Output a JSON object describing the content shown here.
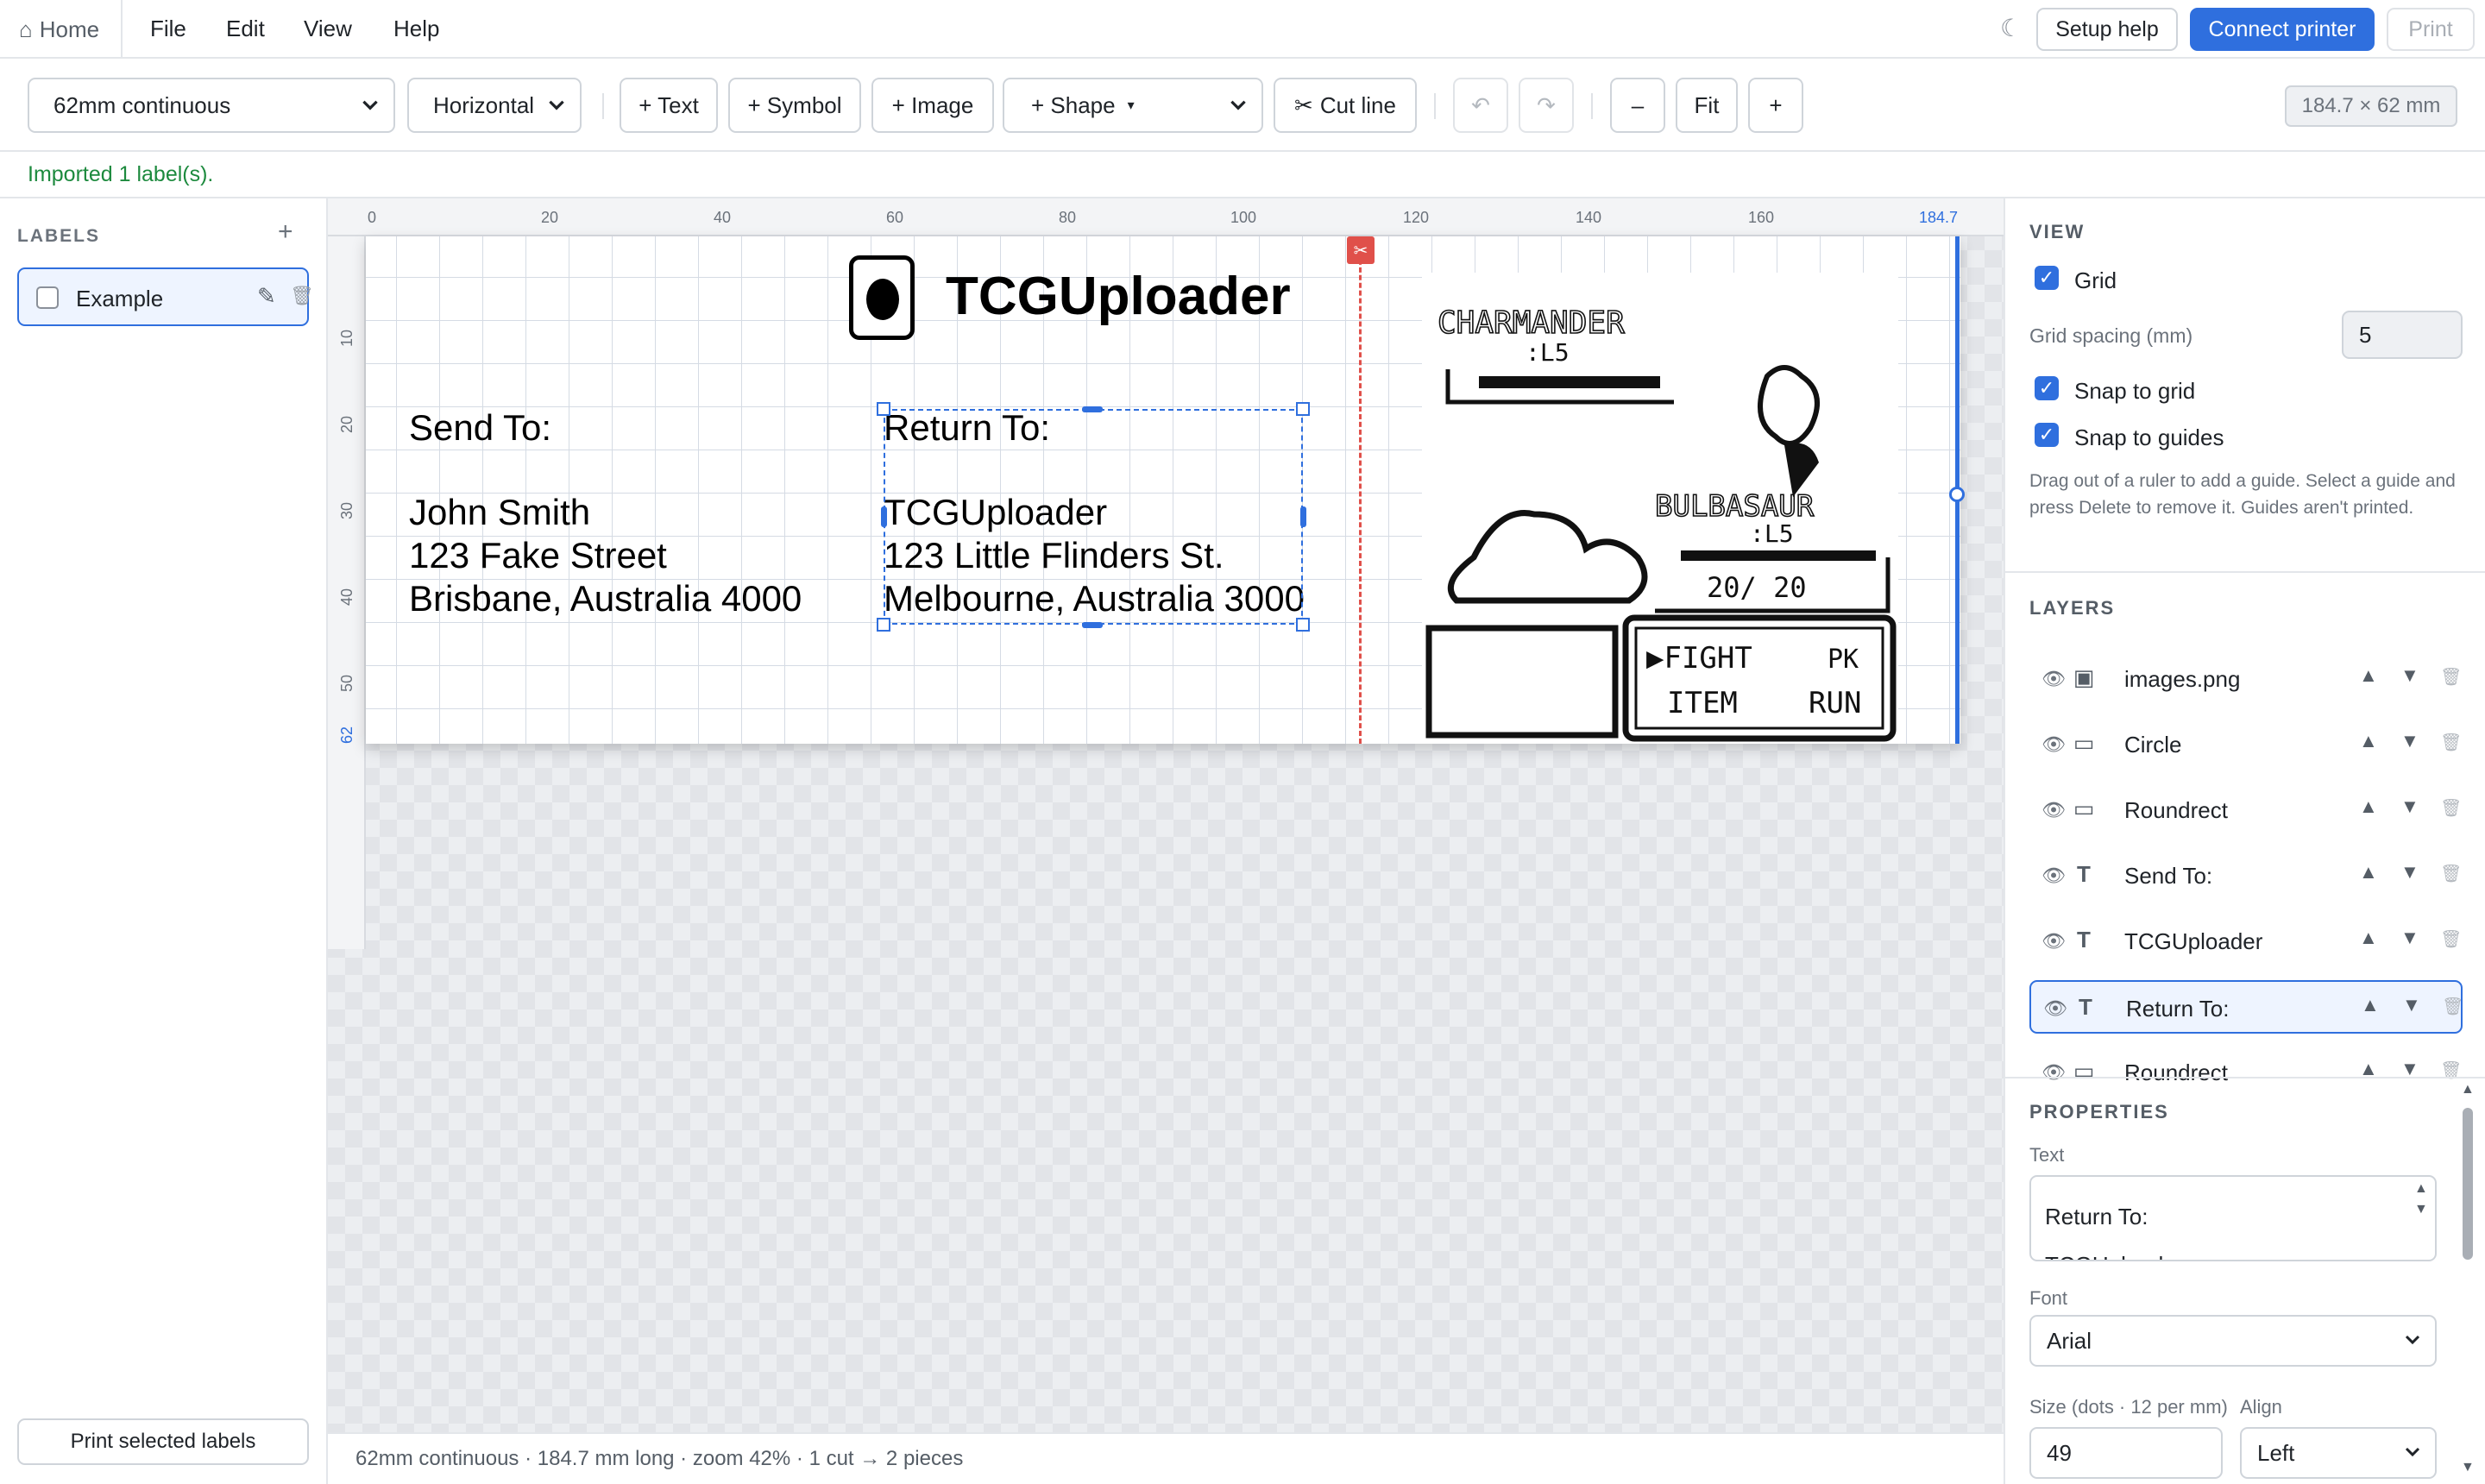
{
  "menubar": {
    "home_label": "Home",
    "menus": [
      "File",
      "Edit",
      "View",
      "Help"
    ],
    "setup_help": "Setup help",
    "connect_printer": "Connect printer",
    "print": "Print"
  },
  "toolbar": {
    "media": "62mm continuous",
    "orientation": "Horizontal",
    "add_text": "+ Text",
    "add_symbol": "+ Symbol",
    "add_image": "+ Image",
    "add_shape": "+ Shape",
    "shape_caret": "▾",
    "cut_line": "Cut line",
    "zoom_out": "–",
    "fit": "Fit",
    "zoom_in": "+",
    "dimensions": "184.7 × 62 mm"
  },
  "status_message": "Imported 1 label(s).",
  "labels_panel": {
    "heading": "LABELS",
    "add": "+",
    "items": [
      {
        "name": "Example",
        "checked": false
      }
    ],
    "print_selected": "Print selected labels"
  },
  "ruler": {
    "top_ticks": [
      "0",
      "20",
      "40",
      "60",
      "80",
      "100",
      "120",
      "140",
      "160"
    ],
    "end_tick": "184.7",
    "left_ticks": [
      "10",
      "20",
      "30",
      "40",
      "50"
    ],
    "left_end_tick": "62"
  },
  "label_content": {
    "logo_text": "TCGUploader",
    "send_to_heading": "Send To:",
    "send_to_lines": [
      "John Smith",
      "123 Fake Street",
      "Brisbane, Australia 4000"
    ],
    "return_to_heading": "Return To:",
    "return_to_lines": [
      "TCGUploader",
      "123 Little Flinders St.",
      "Melbourne, Australia 3000"
    ],
    "game_image": {
      "enemy_name": "CHARMANDER",
      "enemy_level": ":L5",
      "player_name": "BULBASAUR",
      "player_level": ":L5",
      "hp": "20/ 20",
      "menu": [
        "▶FIGHT",
        "PK",
        "ITEM",
        "RUN"
      ]
    }
  },
  "canvas_status": "62mm continuous · 184.7 mm long · zoom 42% · 1 cut → 2 pieces",
  "view_panel": {
    "heading": "VIEW",
    "grid_label": "Grid",
    "grid_checked": true,
    "grid_spacing_label": "Grid spacing (mm)",
    "grid_spacing_value": "5",
    "snap_grid_label": "Snap to grid",
    "snap_grid_checked": true,
    "snap_guides_label": "Snap to guides",
    "snap_guides_checked": true,
    "help_text": "Drag out of a ruler to add a guide. Select a guide and press Delete to remove it. Guides aren't printed."
  },
  "layers_panel": {
    "heading": "LAYERS",
    "items": [
      {
        "kind": "image",
        "name": "images.png",
        "active": false
      },
      {
        "kind": "shape",
        "name": "Circle",
        "active": false
      },
      {
        "kind": "shape",
        "name": "Roundrect",
        "active": false
      },
      {
        "kind": "text",
        "name": "Send To:",
        "active": false
      },
      {
        "kind": "text",
        "name": "TCGUploader",
        "active": false
      },
      {
        "kind": "text",
        "name": "Return To:",
        "active": true
      },
      {
        "kind": "shape",
        "name": "Roundrect",
        "active": false
      }
    ]
  },
  "properties_panel": {
    "heading": "PROPERTIES",
    "text_label": "Text",
    "text_value_line1": "Return To:",
    "text_value_line2": "TCGUploader",
    "font_label": "Font",
    "font_value": "Arial",
    "size_label": "Size (dots · 12 per mm)",
    "size_value": "49",
    "align_label": "Align",
    "align_value": "Left"
  },
  "colors": {
    "accent": "#2f6fde",
    "cut_line": "#e0504a",
    "success": "#1d8a3e"
  }
}
